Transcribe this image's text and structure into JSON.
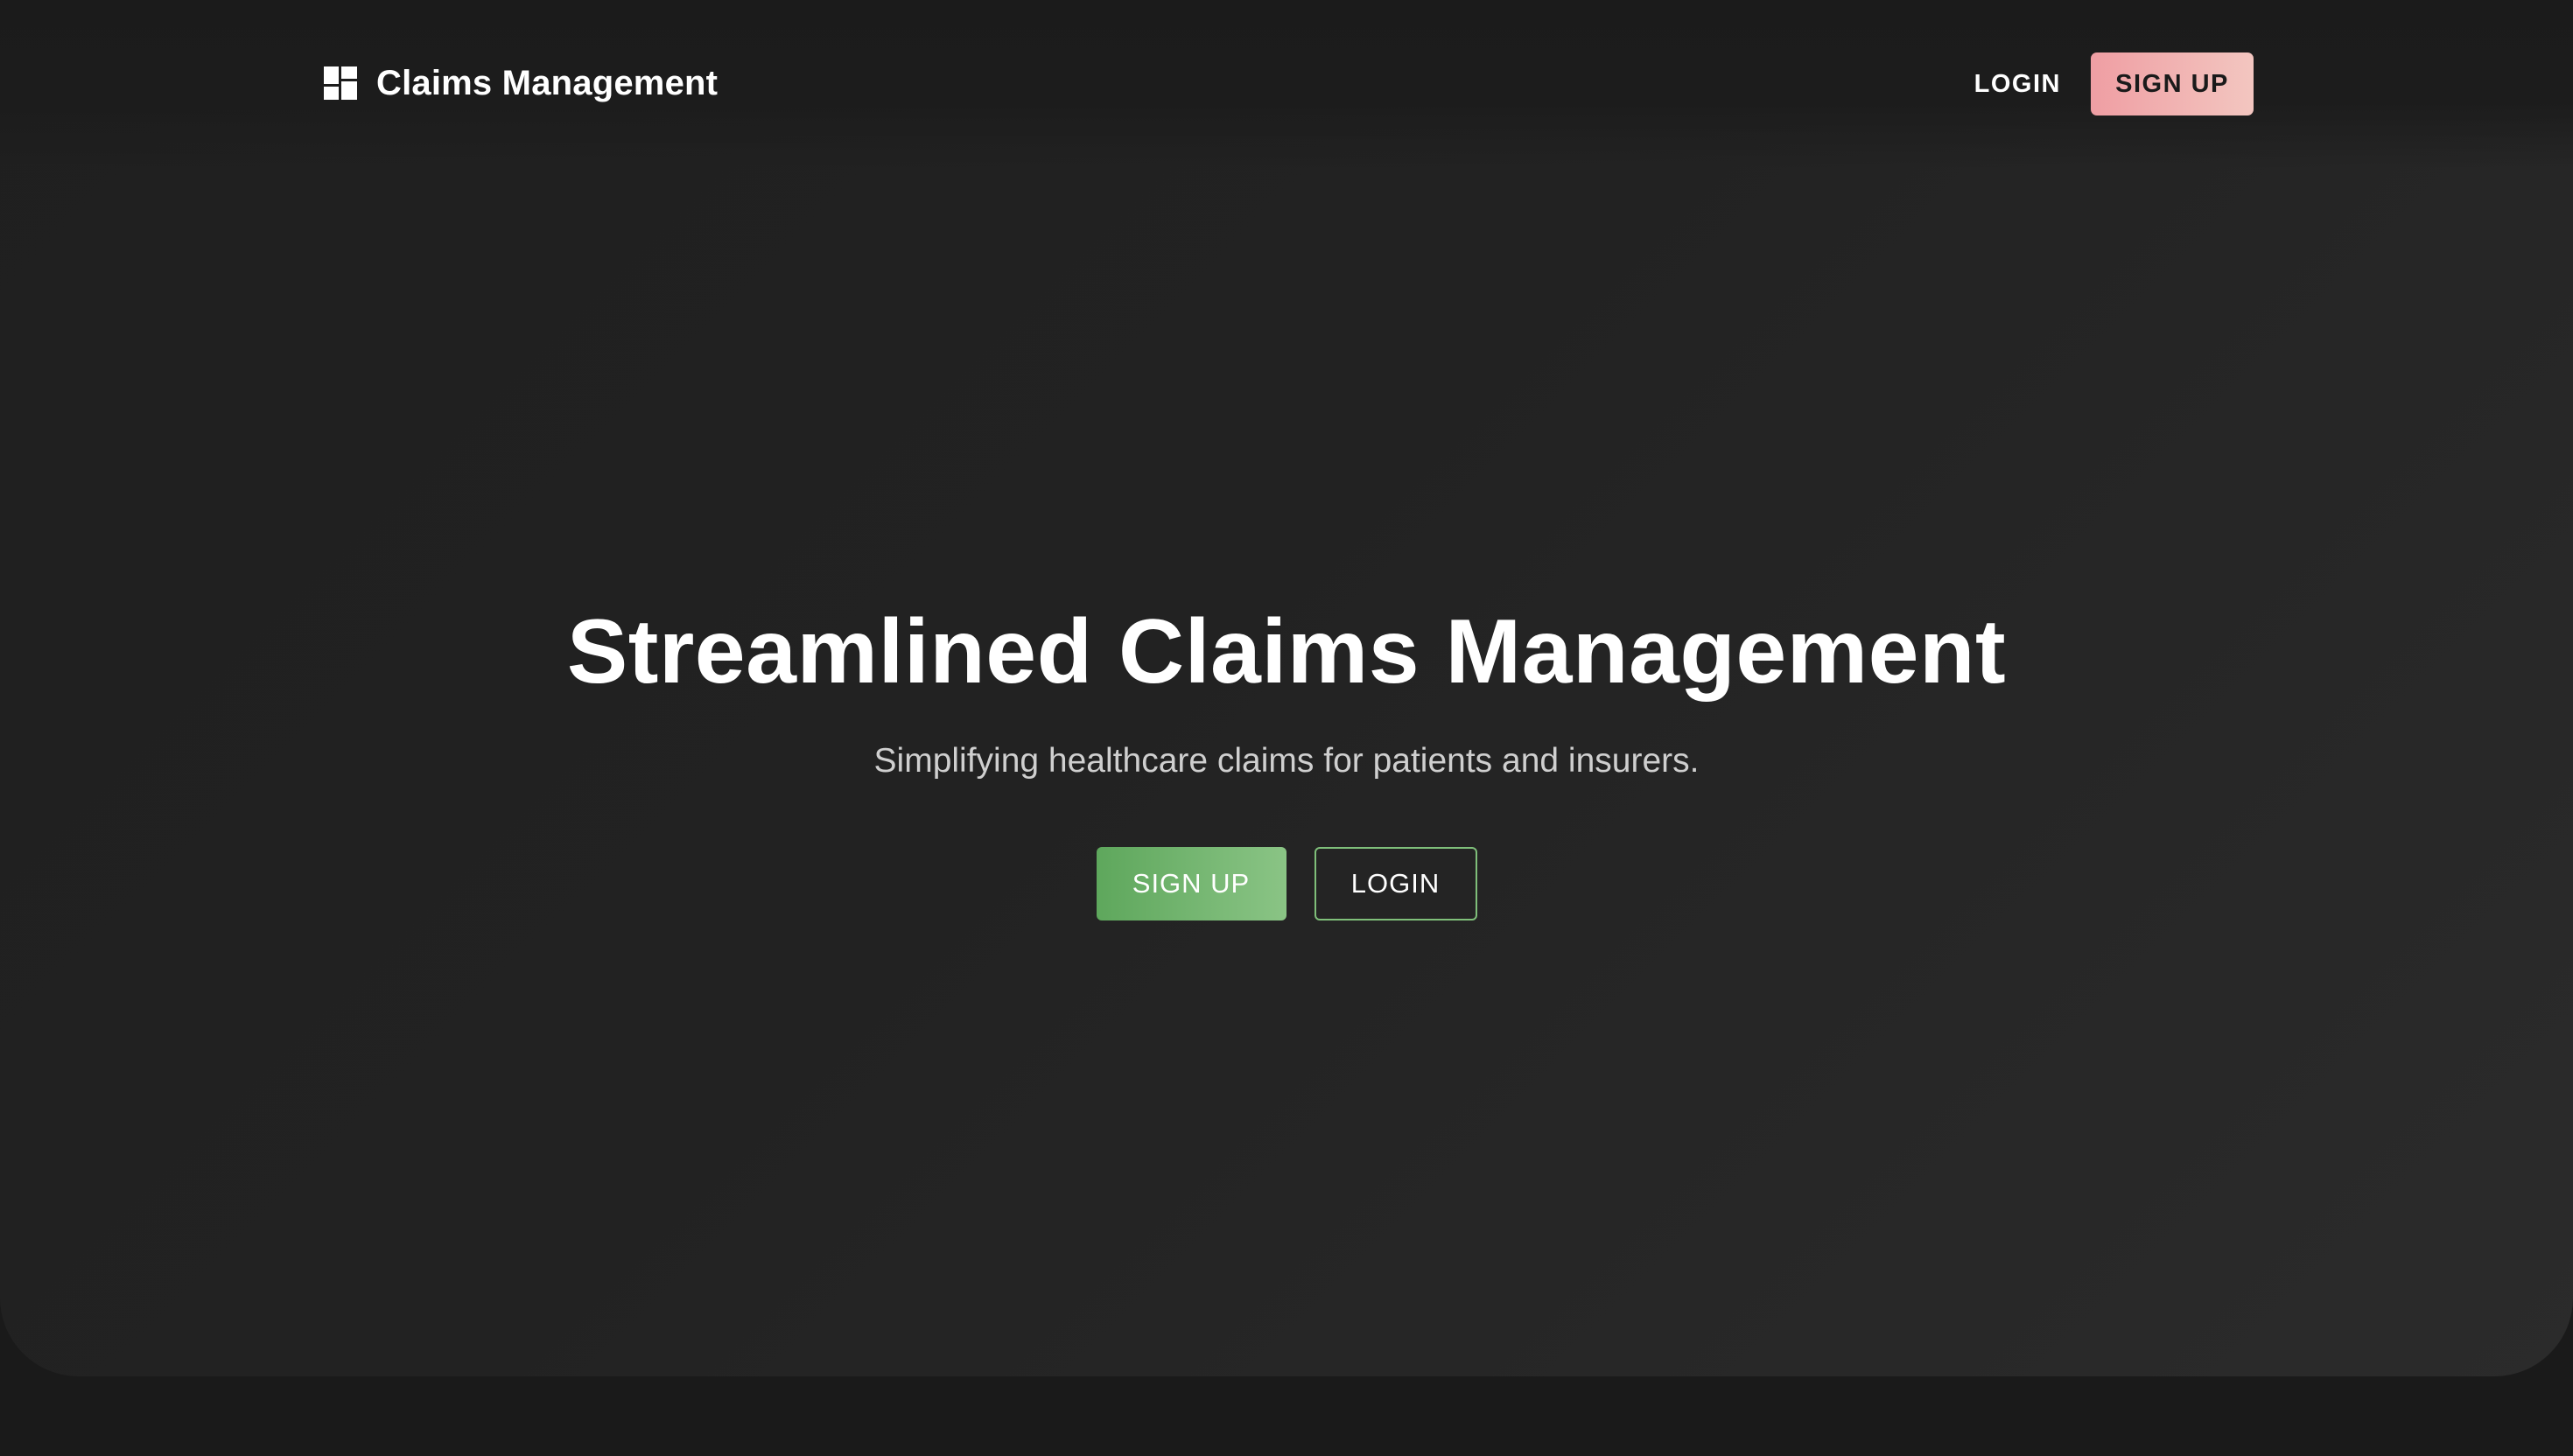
{
  "header": {
    "brand_icon": "dashboard-icon",
    "brand_name": "Claims Management",
    "nav": {
      "login_label": "LOGIN",
      "signup_label": "SIGN UP"
    }
  },
  "hero": {
    "title": "Streamlined Claims Management",
    "subtitle": "Simplifying healthcare claims for patients and insurers.",
    "signup_label": "SIGN UP",
    "login_label": "LOGIN"
  },
  "colors": {
    "background": "#1a1a1a",
    "nav_signup_gradient": [
      "#ef9ea3",
      "#f3c6c0"
    ],
    "cta_signup_gradient": [
      "#5ea75c",
      "#8ac485"
    ],
    "cta_login_border": "#7fbf7a",
    "text_primary": "#ffffff",
    "text_secondary": "#cfcfcf"
  }
}
